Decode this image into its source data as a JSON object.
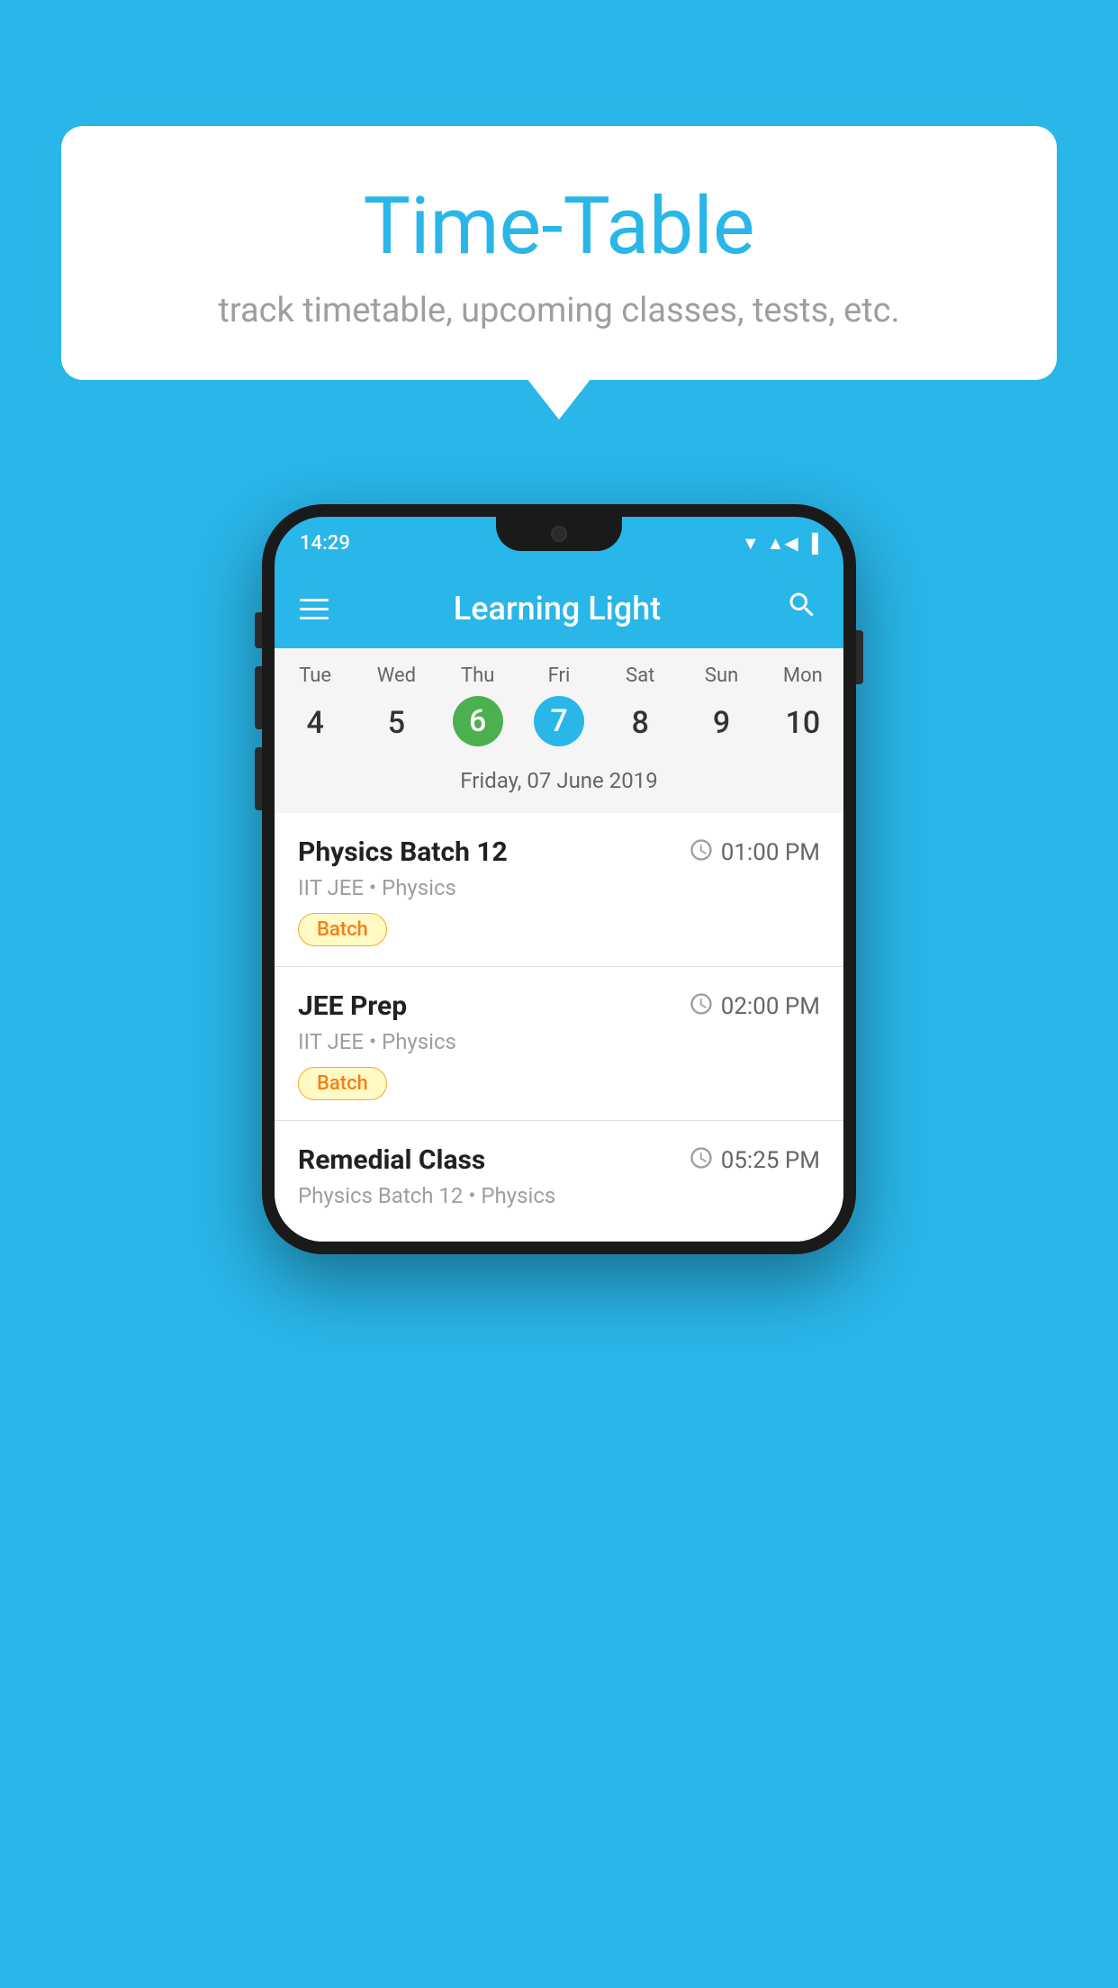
{
  "background_color": "#29B6E8",
  "speech_bubble": {
    "title": "Time-Table",
    "subtitle": "track timetable, upcoming classes, tests, etc."
  },
  "phone": {
    "status_bar": {
      "time": "14:29"
    },
    "app_bar": {
      "title": "Learning Light"
    },
    "calendar": {
      "days": [
        "Tue",
        "Wed",
        "Thu",
        "Fri",
        "Sat",
        "Sun",
        "Mon"
      ],
      "dates": [
        "4",
        "5",
        "6",
        "7",
        "8",
        "9",
        "10"
      ],
      "today_index": 2,
      "selected_index": 3,
      "display_date": "Friday, 07 June 2019"
    },
    "schedule": [
      {
        "title": "Physics Batch 12",
        "time": "01:00 PM",
        "subtitle": "IIT JEE • Physics",
        "badge": "Batch"
      },
      {
        "title": "JEE Prep",
        "time": "02:00 PM",
        "subtitle": "IIT JEE • Physics",
        "badge": "Batch"
      },
      {
        "title": "Remedial Class",
        "time": "05:25 PM",
        "subtitle": "Physics Batch 12 • Physics",
        "badge": null
      }
    ]
  }
}
